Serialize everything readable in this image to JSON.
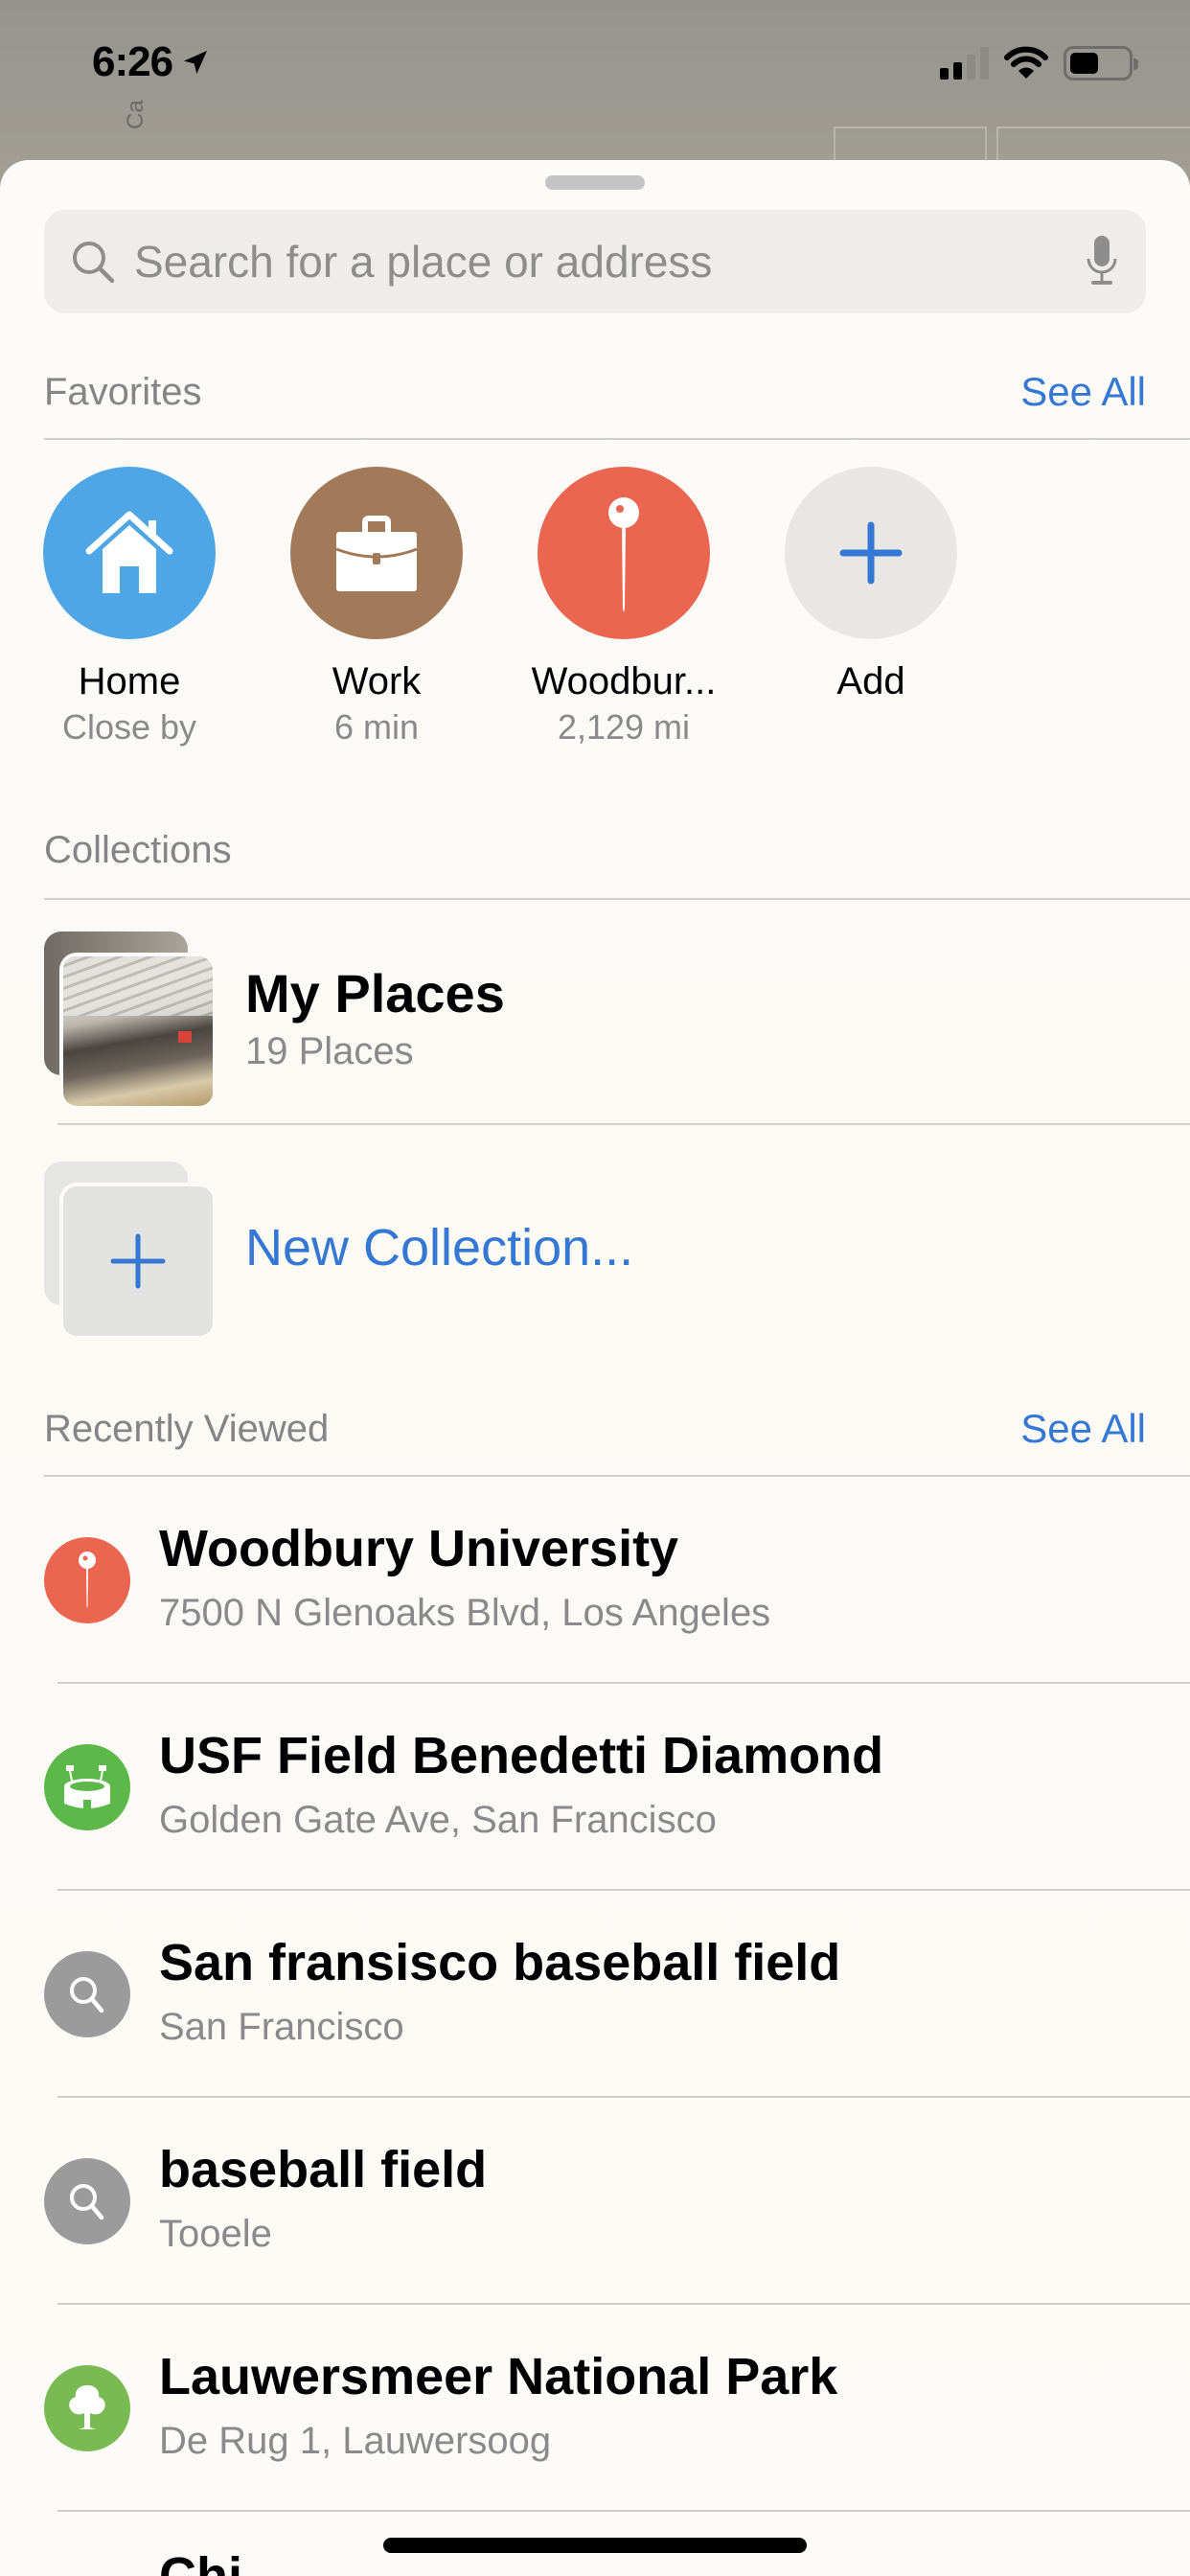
{
  "status_bar": {
    "time": "6:26",
    "location_icon": "location-arrow-icon",
    "signal_bars_filled": 2,
    "signal_bars_total": 4,
    "wifi_icon": "wifi-icon",
    "battery_level_percent": 50
  },
  "map": {
    "partial_label": "Ca"
  },
  "search": {
    "placeholder": "Search for a place or address",
    "value": "",
    "search_icon": "search-icon",
    "mic_icon": "microphone-icon"
  },
  "favorites": {
    "title": "Favorites",
    "see_all": "See All",
    "items": [
      {
        "name": "Home",
        "subtitle": "Close by",
        "icon": "house-icon",
        "color": "#4ea6e6"
      },
      {
        "name": "Work",
        "subtitle": "6 min",
        "icon": "briefcase-icon",
        "color": "#a27a5a"
      },
      {
        "name": "Woodbur...",
        "subtitle": "2,129 mi",
        "icon": "pin-icon",
        "color": "#ea6650"
      },
      {
        "name": "Add",
        "subtitle": "",
        "icon": "plus-icon",
        "color": "#e8e7e5"
      }
    ]
  },
  "collections": {
    "title": "Collections",
    "items": [
      {
        "name": "My Places",
        "subtitle": "19 Places"
      }
    ],
    "new_collection": "New Collection..."
  },
  "recently_viewed": {
    "title": "Recently Viewed",
    "see_all": "See All",
    "items": [
      {
        "title": "Woodbury University",
        "subtitle": "7500 N Glenoaks Blvd, Los Angeles",
        "icon": "pin-icon",
        "color": "#ea6650"
      },
      {
        "title": "USF Field Benedetti Diamond",
        "subtitle": "Golden Gate Ave, San Francisco",
        "icon": "stadium-icon",
        "color": "#5cb848"
      },
      {
        "title": "San fransisco baseball field",
        "subtitle": "San Francisco",
        "icon": "search-icon",
        "color": "#9b9b9b"
      },
      {
        "title": "baseball field",
        "subtitle": "Tooele",
        "icon": "search-icon",
        "color": "#9b9b9b"
      },
      {
        "title": "Lauwersmeer National Park",
        "subtitle": "De Rug 1, Lauwersoog",
        "icon": "tree-icon",
        "color": "#79bb52"
      }
    ],
    "partial_next_title": "Chi"
  },
  "colors": {
    "accent": "#3478d4",
    "secondary_text": "#8a8a8a"
  }
}
